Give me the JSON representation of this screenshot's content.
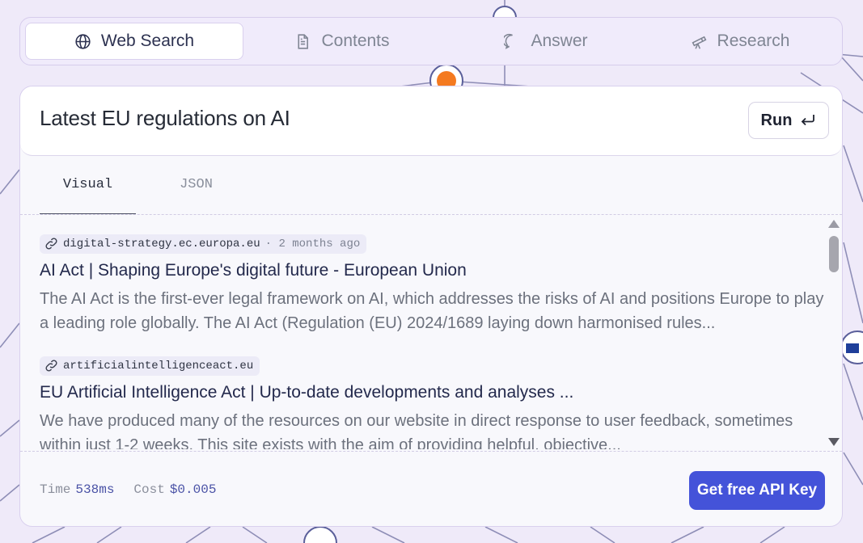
{
  "nav_tabs": [
    {
      "label": "Web Search",
      "icon": "globe-icon",
      "active": true
    },
    {
      "label": "Contents",
      "icon": "document-icon",
      "active": false
    },
    {
      "label": "Answer",
      "icon": "chat-bubble-icon",
      "active": false
    },
    {
      "label": "Research",
      "icon": "telescope-icon",
      "active": false
    }
  ],
  "query": {
    "text": "Latest EU regulations on AI",
    "run_label": "Run",
    "run_icon": "enter-return-icon"
  },
  "view_tabs": [
    {
      "label": "Visual",
      "active": true
    },
    {
      "label": "JSON",
      "active": false
    }
  ],
  "results": [
    {
      "source": "digital-strategy.ec.europa.eu",
      "date": "· 2 months ago",
      "title": "AI Act | Shaping Europe's digital future - European Union",
      "snippet": "The AI Act is the first-ever legal framework on AI, which addresses the risks of AI and positions Europe to play a leading role globally. The AI Act (Regulation (EU) 2024/1689 laying down harmonised rules..."
    },
    {
      "source": "artificialintelligenceact.eu",
      "date": "",
      "title": "EU Artificial Intelligence Act | Up-to-date developments and analyses ...",
      "snippet": "We have produced many of the resources on our website in direct response to user feedback, sometimes within just 1-2 weeks. This site exists with the aim of providing helpful, objective..."
    }
  ],
  "footer": {
    "time_label": "Time",
    "time_value": "538ms",
    "cost_label": "Cost",
    "cost_value": "$0.005",
    "api_button_label": "Get free API Key"
  },
  "colors": {
    "accent": "#4453d9",
    "background": "#efeaf9",
    "card": "#f8f8fc"
  }
}
